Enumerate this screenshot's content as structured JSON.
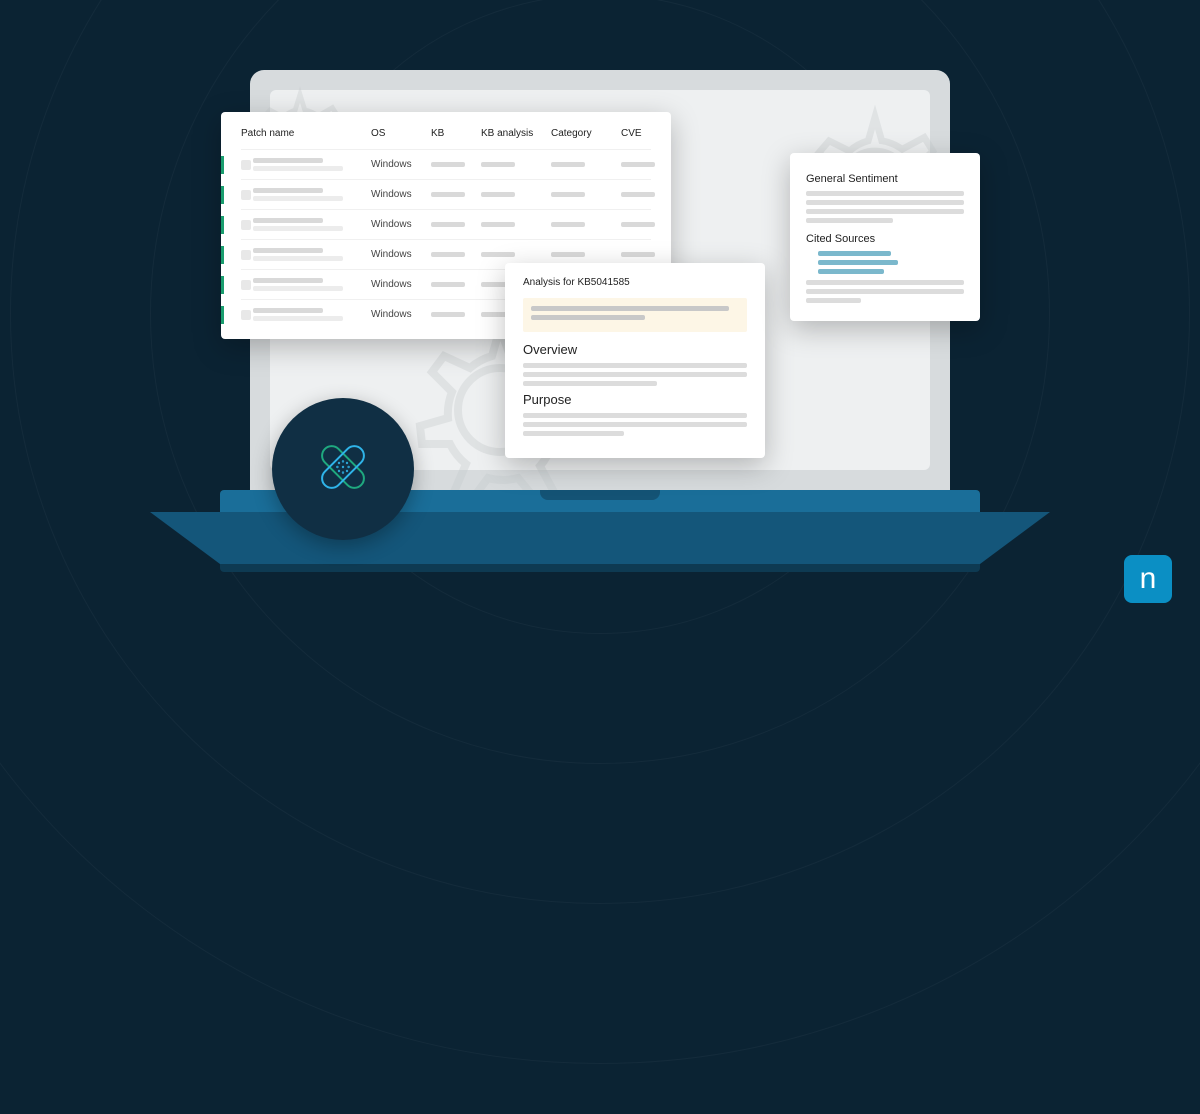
{
  "patch_table": {
    "headers": {
      "name": "Patch name",
      "os": "OS",
      "kb": "KB",
      "kb_analysis": "KB analysis",
      "category": "Category",
      "cve": "CVE"
    },
    "rows": [
      {
        "os": "Windows"
      },
      {
        "os": "Windows"
      },
      {
        "os": "Windows"
      },
      {
        "os": "Windows"
      },
      {
        "os": "Windows"
      },
      {
        "os": "Windows"
      }
    ]
  },
  "analysis": {
    "title": "Analysis for KB5041585",
    "overview_heading": "Overview",
    "purpose_heading": "Purpose"
  },
  "sentiment": {
    "sentiment_heading": "General Sentiment",
    "sources_heading": "Cited Sources"
  },
  "logo": {
    "letter": "n"
  }
}
